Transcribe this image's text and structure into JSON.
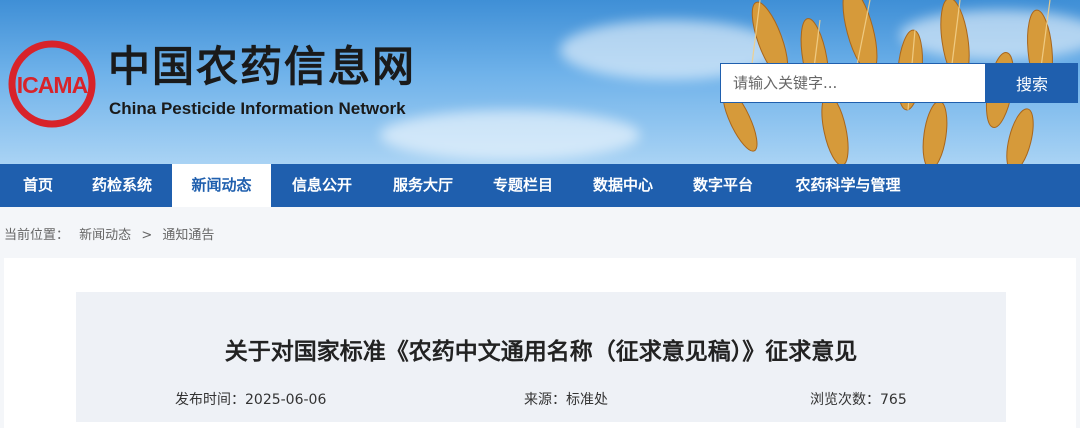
{
  "header": {
    "logo_text": "ICAMA",
    "site_name_cn": "中国农药信息网",
    "site_name_en": "China Pesticide Information Network"
  },
  "search": {
    "placeholder": "请输入关键字...",
    "button_label": "搜索"
  },
  "nav": {
    "items": [
      {
        "label": "首页"
      },
      {
        "label": "药检系统"
      },
      {
        "label": "新闻动态",
        "active": true
      },
      {
        "label": "信息公开"
      },
      {
        "label": "服务大厅"
      },
      {
        "label": "专题栏目"
      },
      {
        "label": "数据中心"
      },
      {
        "label": "数字平台"
      },
      {
        "label": "农药科学与管理"
      }
    ]
  },
  "breadcrumb": {
    "prefix": "当前位置：",
    "items": [
      "新闻动态",
      "通知通告"
    ],
    "separator": ">"
  },
  "article": {
    "title": "关于对国家标准《农药中文通用名称（征求意见稿）》征求意见",
    "publish_label": "发布时间：",
    "publish_date": "2025-06-06",
    "source_label": "来源：",
    "source": "标准处",
    "views_label": "浏览次数：",
    "views": "765"
  },
  "colors": {
    "brand_blue": "#1f5fae",
    "logo_red": "#d8232a"
  }
}
